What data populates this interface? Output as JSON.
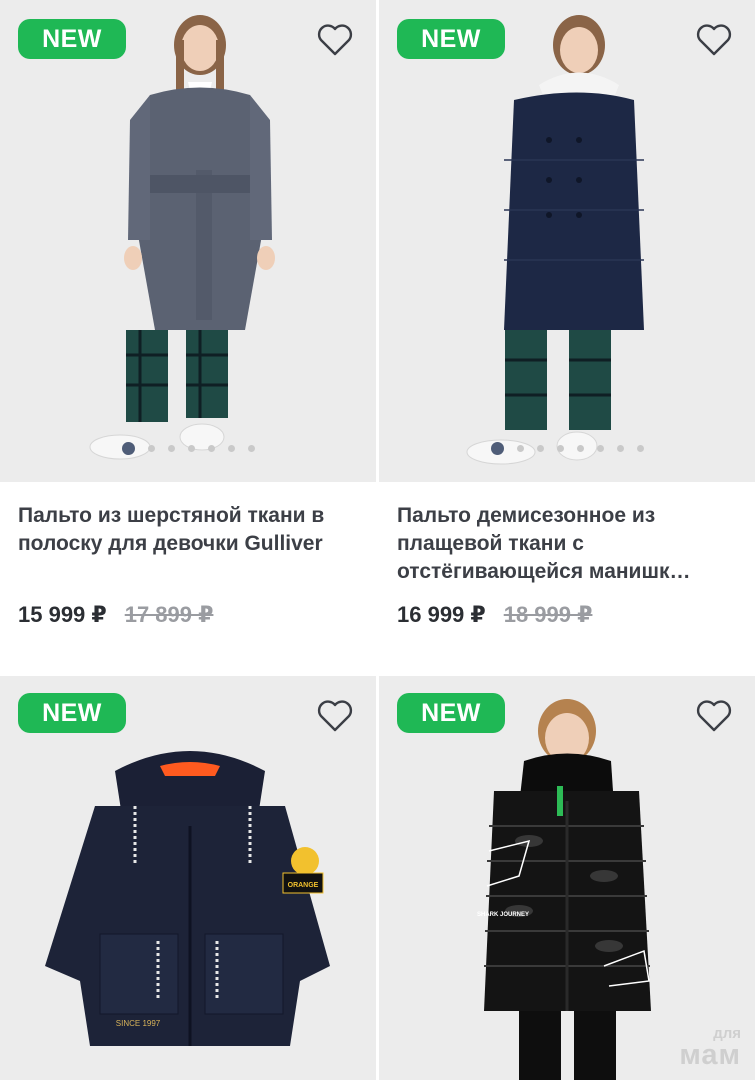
{
  "products": [
    {
      "badge": "NEW",
      "title": "Пальто из шерстяной ткани в полоску для девочки Gulliver",
      "price": "15 999 ₽",
      "old_price": "17 899 ₽",
      "photo_dots": 7,
      "active_dot": 0,
      "photo_icon": "girl-grey-coat-photo"
    },
    {
      "badge": "NEW",
      "title": "Пальто демисезонное из плащевой ткани с отстёгивающейся манишк…",
      "price": "16 999 ₽",
      "old_price": "18 999 ₽",
      "photo_dots": 8,
      "active_dot": 0,
      "photo_icon": "girl-navy-coat-photo"
    },
    {
      "badge": "NEW",
      "title": "",
      "price": "",
      "old_price": "",
      "photo_icon": "navy-parka-photo",
      "patch_text_1": "ORANGE",
      "patch_text_2": "SINCE 1997"
    },
    {
      "badge": "NEW",
      "title": "",
      "price": "",
      "old_price": "",
      "photo_icon": "boy-black-puffer-photo",
      "patch_text_1": "SHARK JOURNEY"
    }
  ],
  "watermark": {
    "small": "для",
    "big": "мам"
  },
  "colors": {
    "badge_green": "#1fb855",
    "background": "#ebebeb",
    "accent_dot": "#4f5d78"
  }
}
